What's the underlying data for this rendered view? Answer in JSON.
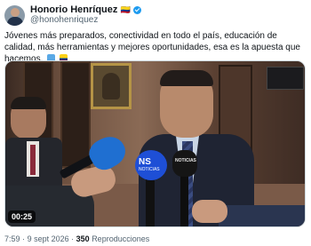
{
  "author": {
    "name": "Honorio Henríquez",
    "name_emoji": "🇨🇴",
    "handle": "@honohenriquez",
    "verified": true
  },
  "tweet": {
    "text": "Jóvenes más preparados, conectividad en todo el país, educación de calidad, más herramientas y mejores oportunidades, esa es la apuesta que hacemos.",
    "emojis": [
      "🇸🇴",
      "🇨🇴"
    ]
  },
  "media": {
    "type": "video",
    "duration": "00:25",
    "mic_labels": {
      "ns": "NS",
      "ns_sub": "NOTICIAS",
      "black": "NOTICIAS"
    }
  },
  "meta": {
    "time": "7:59",
    "separator": "·",
    "date": "9 sept 2026",
    "views_count": "350",
    "views_label": "Reproducciones"
  },
  "colors": {
    "verified": "#1d9bf0",
    "text": "#0f1419",
    "secondary": "#536471"
  }
}
